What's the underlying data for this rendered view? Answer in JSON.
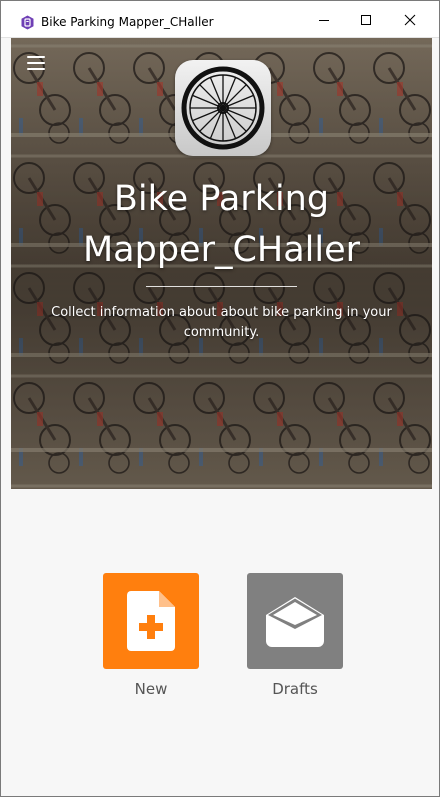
{
  "window": {
    "title": "Bike Parking Mapper_CHaller",
    "app_icon": "app-icon",
    "controls": [
      "minimize-icon",
      "maximize-icon",
      "close-icon"
    ]
  },
  "hero": {
    "menu_icon": "menu-icon",
    "logo_icon": "bike-wheel-icon",
    "title": "Bike Parking Mapper_CHaller",
    "description": "Collect information about about bike parking in your community."
  },
  "actions": {
    "new": {
      "label": "New",
      "icon": "new-document-icon",
      "color": "#ff7f0e"
    },
    "drafts": {
      "label": "Drafts",
      "icon": "drafts-envelope-icon",
      "color": "#808080"
    }
  }
}
